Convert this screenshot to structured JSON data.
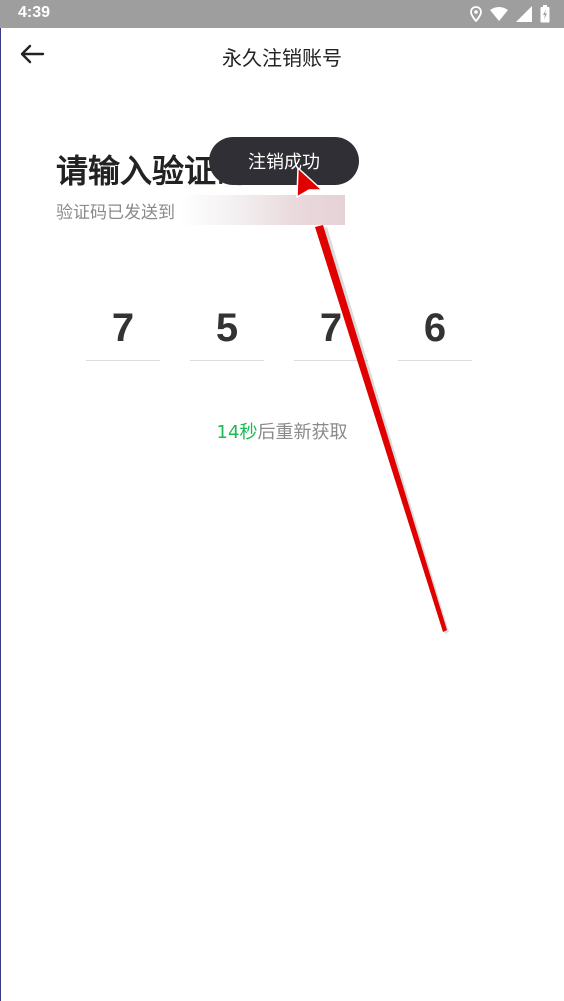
{
  "status_bar": {
    "time": "4:39",
    "icons": [
      "location-icon",
      "wifi-icon",
      "signal-icon",
      "battery-icon"
    ]
  },
  "app_bar": {
    "back_icon": "arrow-left-icon",
    "title": "永久注销账号"
  },
  "verify": {
    "heading": "请输入验证码",
    "sent_to": "验证码已发送到",
    "code_digits": [
      "7",
      "5",
      "7",
      "6"
    ],
    "countdown": "14秒",
    "resend_suffix": "后重新获取"
  },
  "toast": {
    "message": "注销成功"
  },
  "colors": {
    "status_bar": "#9e9e9e",
    "accent_green": "#1db954",
    "toast_bg": "#2f2f35",
    "text_primary": "#222222",
    "text_secondary": "#8a8a8a",
    "annotation_arrow": "#e00000"
  }
}
